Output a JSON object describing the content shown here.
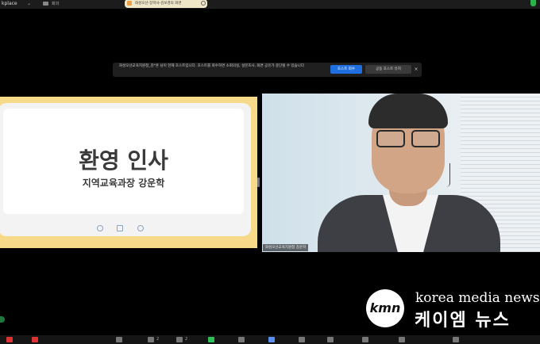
{
  "topbar": {
    "workspace_label": "kplace",
    "chevron": "⌄",
    "meeting_label": "회의",
    "share_label": "화성오산-장학사-김보경의 화면",
    "security_icon": "shield-icon",
    "security_color": "#29b34a"
  },
  "notice": {
    "text": "화성오산교육지원청_김*훈 님이 현재 호스트입니다. 호스트를 회수하면 소회의실, 설문조사, 화면 공유가 중단될 수 있습니다",
    "primary_label": "호스트 회수",
    "secondary_label": "공동 호스트 유지",
    "close_label": "×",
    "primary_color": "#1f6fe0"
  },
  "slide": {
    "title": "환영 인사",
    "subtitle": "지역교육과장 강운학",
    "icons": [
      "settings-icon",
      "pen-icon",
      "gear-icon"
    ]
  },
  "speaker": {
    "name_tag": "화성오산교육지원청 강운학"
  },
  "watermark": {
    "logo_text": "kmn",
    "brand_en": "korea media news",
    "brand_ko": "케이엠 뉴스"
  },
  "toolbar": {
    "items": [
      {
        "icon": "mic-icon",
        "color": "#d33"
      },
      {
        "icon": "video-icon",
        "color": "#d33"
      },
      {
        "icon": "security-icon",
        "color": "#777"
      },
      {
        "icon": "participants-icon",
        "color": "#777"
      },
      {
        "icon": "chat-icon",
        "color": "#777"
      },
      {
        "icon": "share-icon",
        "color": "#2cbf5a"
      },
      {
        "icon": "record-icon",
        "color": "#777"
      },
      {
        "icon": "reactions-icon",
        "color": "#5b8ff2"
      },
      {
        "icon": "apps-icon",
        "color": "#777"
      },
      {
        "icon": "whiteboard-icon",
        "color": "#777"
      },
      {
        "icon": "notes-icon",
        "color": "#777"
      },
      {
        "icon": "info-icon",
        "color": "#777"
      },
      {
        "icon": "more-icon",
        "color": "#777"
      }
    ],
    "participants_count": "2",
    "chat_label": "2"
  }
}
